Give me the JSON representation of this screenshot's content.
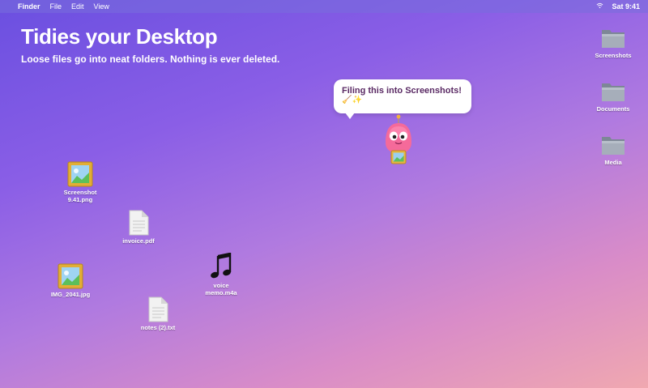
{
  "menubar": {
    "apple": "",
    "app_name": "Finder",
    "items": [
      "File",
      "Edit",
      "View"
    ],
    "clock": "Sat 9:41",
    "wifi_icon": "wifi-icon"
  },
  "hero": {
    "title": "Tidies your Desktop",
    "subtitle": "Loose files go into neat folders. Nothing is ever deleted."
  },
  "bubble": {
    "text": "Filing this into Screenshots!",
    "emoji": "🧹✨"
  },
  "folders": [
    {
      "label": "Screenshots"
    },
    {
      "label": "Documents"
    },
    {
      "label": "Media"
    }
  ],
  "files": [
    {
      "label1": "Screenshot",
      "label2": "9.41.png",
      "type": "image"
    },
    {
      "label1": "invoice.pdf",
      "label2": "",
      "type": "document"
    },
    {
      "label1": "IMG_2041.jpg",
      "label2": "",
      "type": "image"
    },
    {
      "label1": "voice",
      "label2": "memo.m4a",
      "type": "audio"
    },
    {
      "label1": "notes (2).txt",
      "label2": "",
      "type": "document"
    }
  ]
}
